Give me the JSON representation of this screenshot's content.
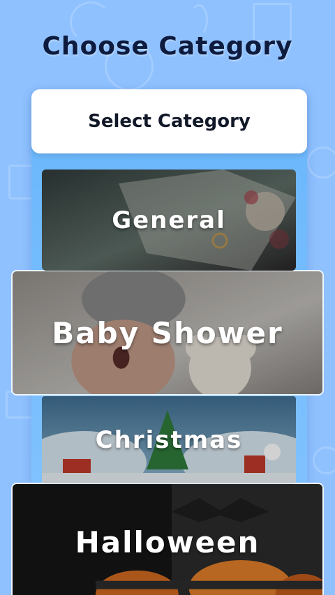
{
  "page": {
    "title": "Choose Category"
  },
  "panel": {
    "header": "Select Category"
  },
  "categories": [
    {
      "label": "General",
      "theme": "general",
      "colors": [
        "#3f4f50",
        "#708783"
      ]
    },
    {
      "label": "Baby Shower",
      "theme": "baby-shower",
      "colors": [
        "#b6b1ab",
        "#6e6a66"
      ]
    },
    {
      "label": "Christmas",
      "theme": "christmas",
      "colors": [
        "#4c7fa0",
        "#c4dbe6"
      ]
    },
    {
      "label": "Halloween",
      "theme": "halloween",
      "colors": [
        "#141414",
        "#c8661f"
      ]
    }
  ],
  "colors": {
    "background": "#8fc1ff",
    "panel": "#74bbfc",
    "title": "#0d1b3e"
  }
}
